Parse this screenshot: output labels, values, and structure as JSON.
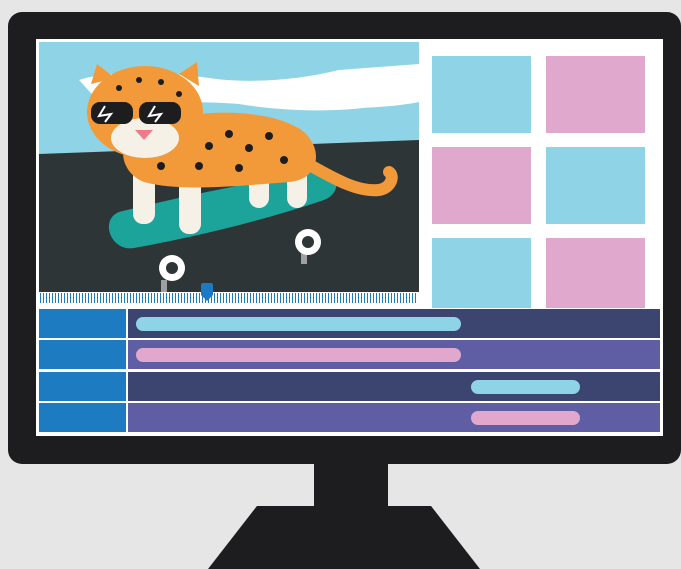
{
  "colors": {
    "sky": "#8fd3e6",
    "ground": "#2e3537",
    "thumb_blue": "#8fd3e6",
    "thumb_pink": "#e0a8cd",
    "track_head": "#1d7bc1",
    "track_dark": "#3c4470",
    "track_purple": "#5f5ea5",
    "clip_blue": "#8fd3e6",
    "clip_pink": "#e0a8cd",
    "skateboard": "#1ca39a"
  },
  "preview": {
    "subject": "leopard-on-skateboard"
  },
  "thumbnails": [
    {
      "color": "blue"
    },
    {
      "color": "pink"
    },
    {
      "color": "pink"
    },
    {
      "color": "blue"
    },
    {
      "color": "blue"
    },
    {
      "color": "pink"
    }
  ],
  "timeline": {
    "playhead_fraction": 0.45,
    "tracks": [
      {
        "clip_color": "blue",
        "clip_start_fraction": 0.0,
        "clip_end_fraction": 0.63
      },
      {
        "clip_color": "pink",
        "clip_start_fraction": 0.0,
        "clip_end_fraction": 0.63
      },
      {
        "clip_color": "blue",
        "clip_start_fraction": 0.65,
        "clip_end_fraction": 0.86
      },
      {
        "clip_color": "pink",
        "clip_start_fraction": 0.65,
        "clip_end_fraction": 0.86
      }
    ]
  }
}
